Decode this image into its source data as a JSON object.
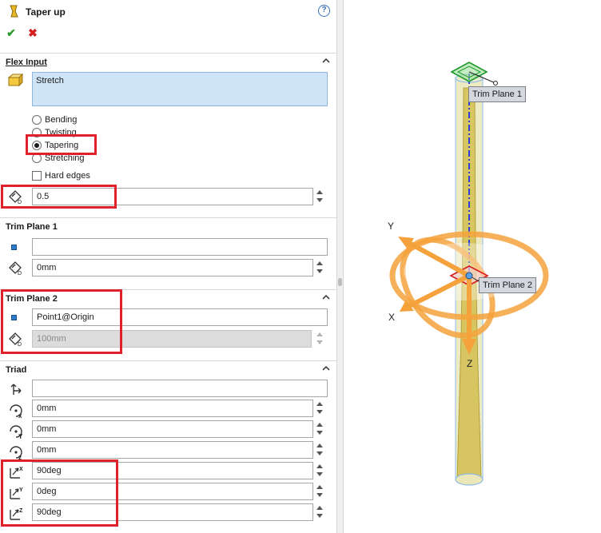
{
  "header": {
    "title": "Taper up",
    "help_glyph": "?"
  },
  "actions": {
    "ok_glyph": "✔",
    "cancel_glyph": "✖"
  },
  "flex_input": {
    "heading": "Flex Input",
    "selected_body": "Stretch",
    "options": [
      {
        "label": "Bending",
        "selected": false
      },
      {
        "label": "Twisting",
        "selected": false
      },
      {
        "label": "Tapering",
        "selected": true
      },
      {
        "label": "Stretching",
        "selected": false
      }
    ],
    "hard_edges_label": "Hard edges",
    "hard_edges_checked": false,
    "taper_factor": "0.5"
  },
  "trim_plane_1": {
    "heading": "Trim Plane 1",
    "entity": "",
    "offset": "0mm"
  },
  "trim_plane_2": {
    "heading": "Trim Plane 2",
    "entity": "Point1@Origin",
    "offset": "100mm"
  },
  "triad": {
    "heading": "Triad",
    "entity": "",
    "x_position": "0mm",
    "y_position": "0mm",
    "z_position": "0mm",
    "x_rotation": "90deg",
    "y_rotation": "0deg",
    "z_rotation": "90deg"
  },
  "viewport": {
    "callout_plane1": "Trim Plane 1",
    "callout_plane2": "Trim Plane 2",
    "axis_y": "Y",
    "axis_x": "X",
    "axis_z": "Z"
  },
  "colors": {
    "highlight": "#e0202a",
    "selection_fill": "#cfe4f7",
    "rod": "#e3d98a",
    "triad_orange": "#f5a23c"
  }
}
